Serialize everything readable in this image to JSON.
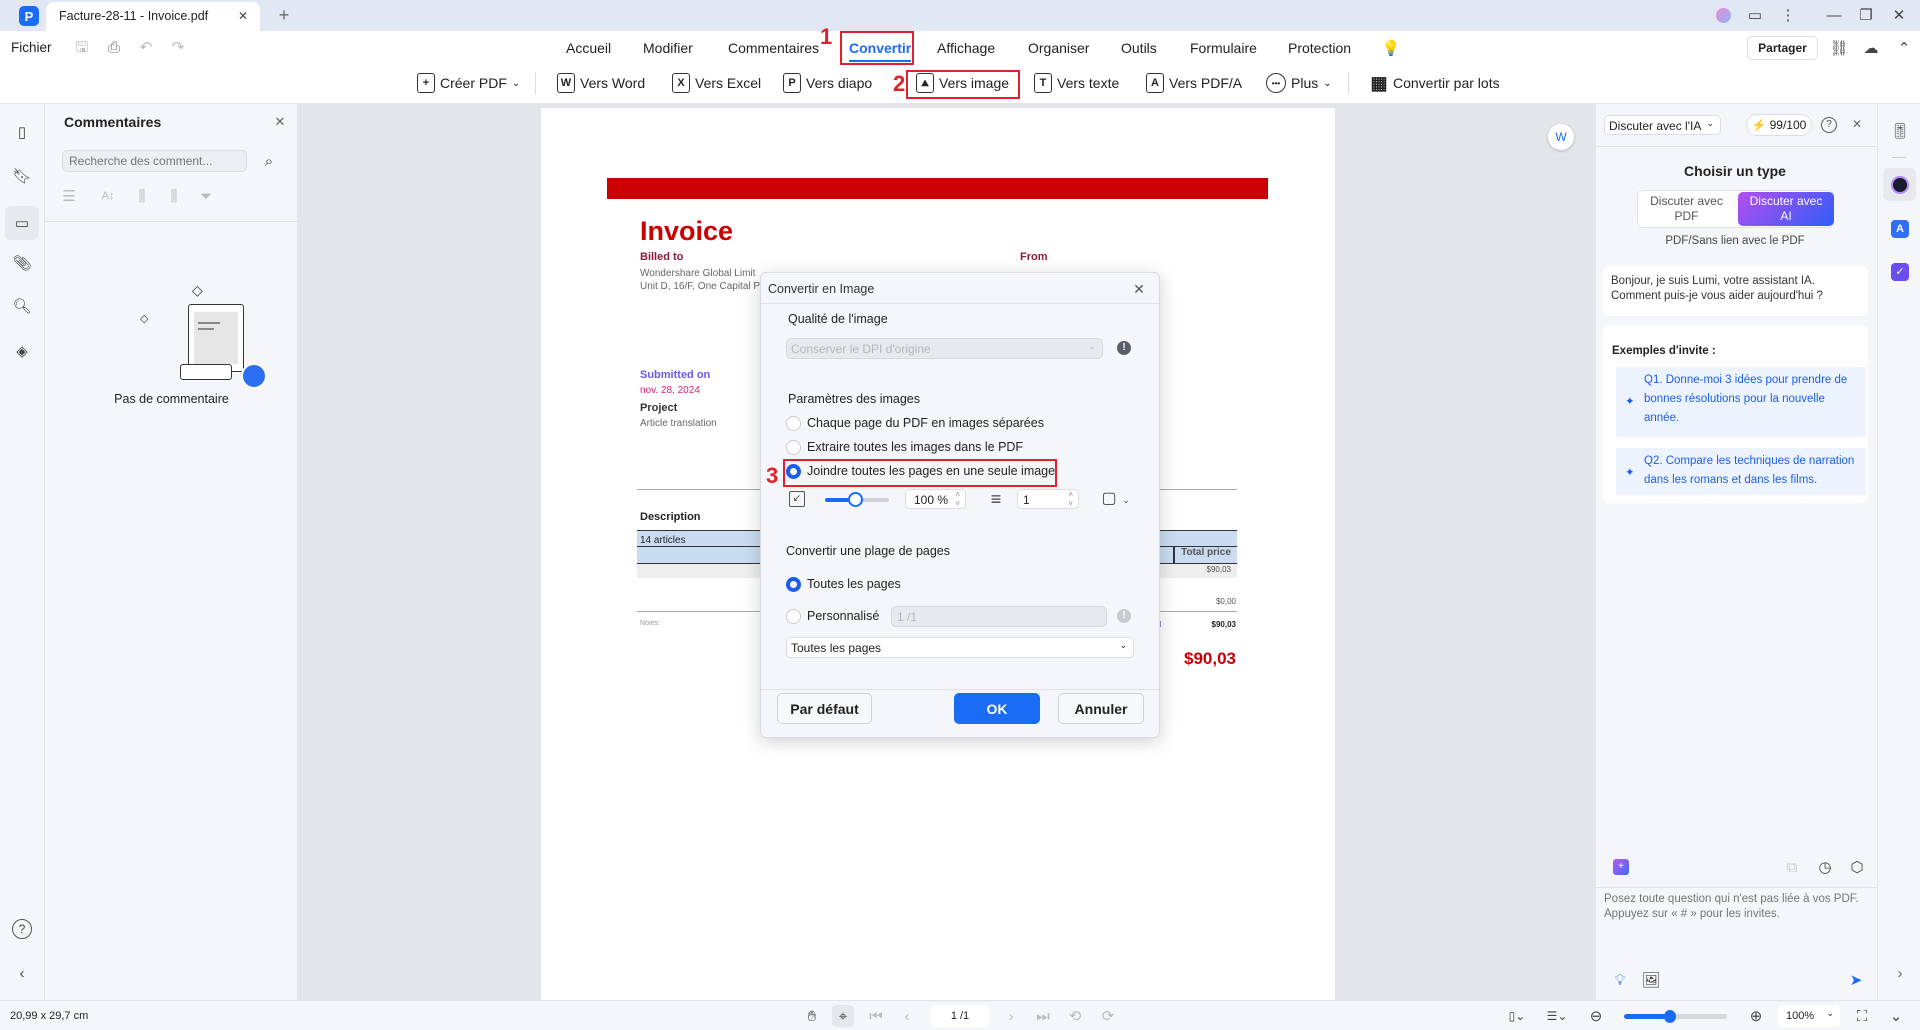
{
  "window": {
    "tab_title": "Facture-28-11 - Invoice.pdf",
    "new_tab": "+",
    "app_icon": "pdfelement-logo-icon"
  },
  "menu": {
    "file": "Fichier",
    "items": [
      "Accueil",
      "Modifier",
      "Commentaires",
      "Convertir",
      "Affichage",
      "Organiser",
      "Outils",
      "Formulaire",
      "Protection"
    ],
    "active": "Convertir",
    "share": "Partager"
  },
  "toolbar": {
    "items": [
      {
        "label": "Créer PDF",
        "glyph": "+",
        "dropdown": "⌄"
      },
      {
        "label": "Vers Word",
        "glyph": "W"
      },
      {
        "label": "Vers Excel",
        "glyph": "X"
      },
      {
        "label": "Vers diapo",
        "glyph": "P"
      },
      {
        "label": "Vers image",
        "glyph": "⛰"
      },
      {
        "label": "Vers texte",
        "glyph": "T"
      },
      {
        "label": "Vers PDF/A",
        "glyph": "A"
      },
      {
        "label": "Plus",
        "glyph": "•••",
        "dropdown": "⌄"
      },
      {
        "label": "Convertir par lots",
        "glyph": "▦"
      }
    ]
  },
  "annotations": {
    "step1": "1",
    "step2": "2",
    "step3": "3",
    "highlight_color": "#e0202a"
  },
  "comments_panel": {
    "title": "Commentaires",
    "search_placeholder": "Recherche des comment...",
    "empty_text": "Pas de commentaire"
  },
  "invoice": {
    "title": "Invoice",
    "billed_to": "Billed to",
    "billed_line1": "Wondershare Global Limit",
    "billed_line2": "Unit D, 16/F, One Capital P",
    "from": "From",
    "submitted_on": "Submitted on",
    "date": "nov. 28, 2024",
    "project": "Project",
    "project_value": "Article translation",
    "description": "Description",
    "row1": "14 articles",
    "total_price": "Total price",
    "amount1": "$90,03",
    "amount2": "$0,00",
    "notes": "Notes:",
    "total_label": "tal",
    "total_value": "$90,03",
    "grand_total": "$90,03",
    "brand_color": "#cc0000"
  },
  "dialog": {
    "title": "Convertir en Image",
    "quality_label": "Qualité de l'image",
    "quality_value": "Conserver le DPI d'origine",
    "params_label": "Paramètres des images",
    "options": [
      "Chaque page du PDF en images séparées",
      "Extraire toutes les images dans le PDF",
      "Joindre toutes les pages en une seule image"
    ],
    "selected_option": 2,
    "scale_value": "100 %",
    "scale_slider_percent": 100,
    "spacing_value": "1",
    "range_label": "Convertir une plage de pages",
    "range_all": "Toutes les pages",
    "range_custom": "Personnalisé",
    "range_custom_value": "1 /1",
    "range_select": "Toutes les pages",
    "btn_default": "Par défaut",
    "btn_ok": "OK",
    "btn_cancel": "Annuler",
    "accent": "#1a6cf5"
  },
  "ai_panel": {
    "mode": "Discuter avec l'IA",
    "credits": "99/100",
    "choose_type": "Choisir un type",
    "type_pdf": "Discuter avec PDF",
    "type_ai": "Discuter avec AI",
    "type_hint": "PDF/Sans lien avec le PDF",
    "greeting": "Bonjour, je suis Lumi, votre assistant IA. Comment puis-je vous aider aujourd'hui ?",
    "examples_title": "Exemples d'invite :",
    "examples": [
      "Q1. Donne-moi 3 idées pour prendre de bonnes résolutions pour la nouvelle année.",
      "Q2. Compare les techniques de narration dans les romans et dans les films."
    ],
    "input_placeholder": "Posez toute question qui n'est pas liée à vos PDF. Appuyez sur « # » pour les invites."
  },
  "status": {
    "page_size": "20,99 x 29,7 cm",
    "page": "1 /1",
    "zoom": "100%",
    "zoom_slider_percent": 45
  }
}
